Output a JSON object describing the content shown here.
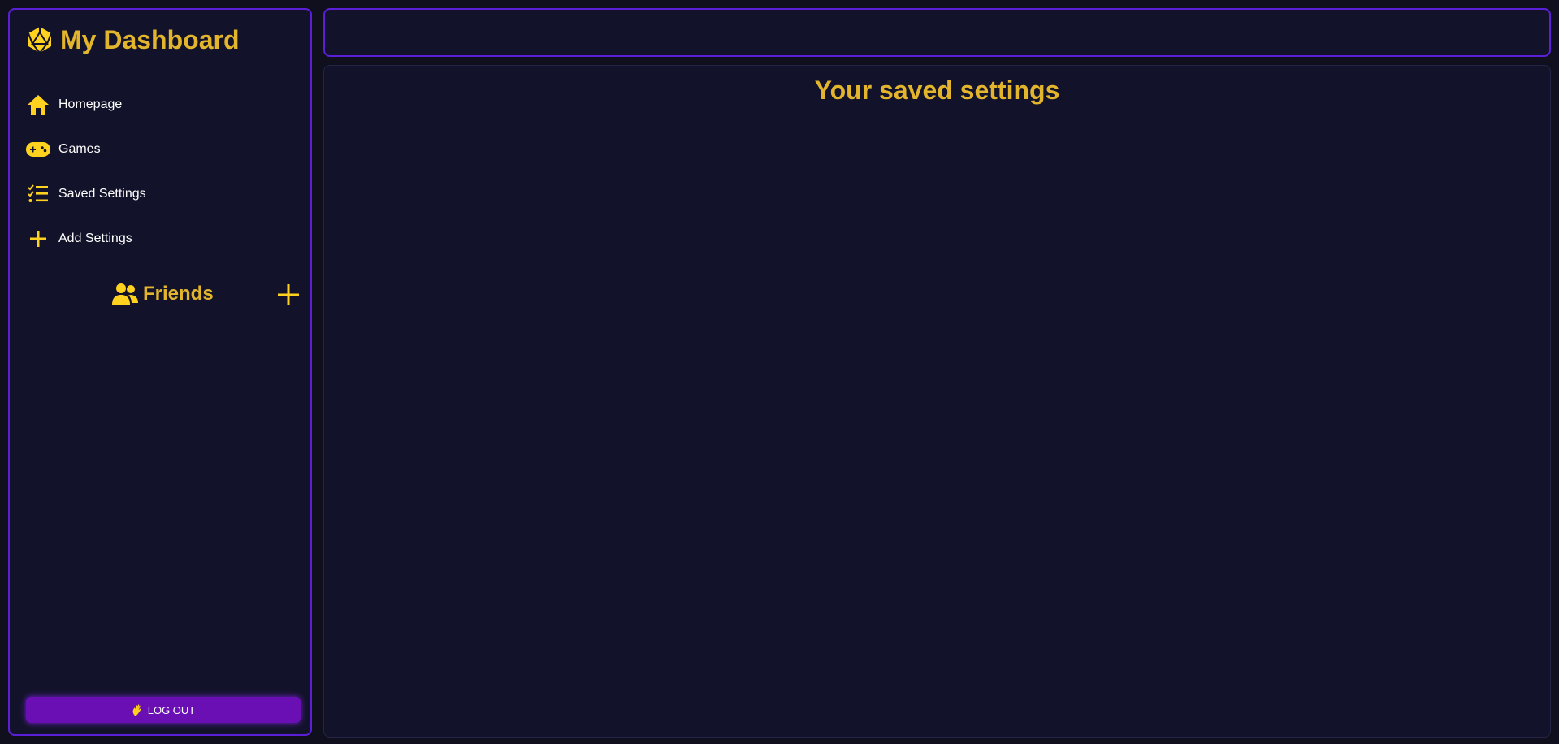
{
  "sidebar": {
    "brand": {
      "title": "My Dashboard",
      "icon": "d20-dice-icon"
    },
    "nav": [
      {
        "label": "Homepage",
        "icon": "home-icon"
      },
      {
        "label": "Games",
        "icon": "gamepad-icon"
      },
      {
        "label": "Saved Settings",
        "icon": "checklist-icon"
      },
      {
        "label": "Add Settings",
        "icon": "plus-icon"
      }
    ],
    "friends": {
      "label": "Friends",
      "icon": "users-icon",
      "add_icon": "plus-icon"
    },
    "logout": {
      "label": "LOG OUT",
      "icon": "hand-wave-icon"
    }
  },
  "main": {
    "heading": "Your saved settings"
  },
  "colors": {
    "accent_gold": "#e2b52c",
    "icon_yellow": "#ffd21f",
    "border_purple": "#5b1fd8",
    "button_purple": "#6a0fb3",
    "panel_bg": "#12132a",
    "page_bg": "#0f0f1d"
  }
}
